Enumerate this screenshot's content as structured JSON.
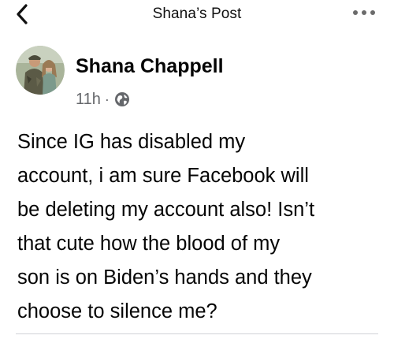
{
  "header": {
    "title": "Shana’s Post"
  },
  "post": {
    "author": "Shana Chappell",
    "time": "11h",
    "separator": "·",
    "privacy_icon": "globe-icon",
    "text": "Since IG has disabled my\naccount, i am sure Facebook will\nbe deleting my account also! Isn’t\nthat cute how the blood of my\nson is on Biden’s hands and they\nchoose to silence me?"
  },
  "icons": {
    "back": "back-chevron-icon",
    "more": "more-options-icon"
  },
  "colors": {
    "text": "#050505",
    "meta": "#65676b"
  }
}
